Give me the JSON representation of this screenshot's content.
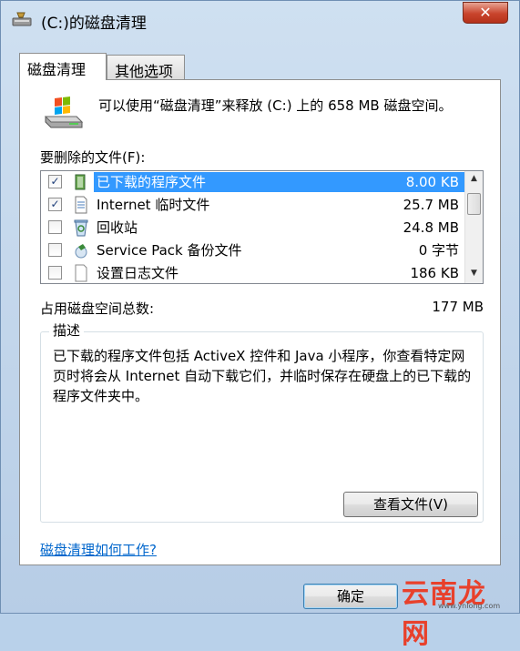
{
  "window": {
    "title": "(C:)的磁盘清理",
    "close_label": "✕"
  },
  "tabs": [
    {
      "label": "磁盘清理",
      "active": true
    },
    {
      "label": "其他选项",
      "active": false
    }
  ],
  "intro": "可以使用“磁盘清理”来释放 (C:) 上的 658 MB 磁盘空间。",
  "files_label": "要删除的文件(F):",
  "files": [
    {
      "name": "已下载的程序文件",
      "size": "8.00 KB",
      "checked": true,
      "selected": true,
      "icon": "folder-icon"
    },
    {
      "name": "Internet 临时文件",
      "size": "25.7 MB",
      "checked": true,
      "selected": false,
      "icon": "document-lock-icon"
    },
    {
      "name": "回收站",
      "size": "24.8 MB",
      "checked": false,
      "selected": false,
      "icon": "recycle-bin-icon"
    },
    {
      "name": "Service Pack 备份文件",
      "size": "0 字节",
      "checked": false,
      "selected": false,
      "icon": "service-pack-icon"
    },
    {
      "name": "设置日志文件",
      "size": "186 KB",
      "checked": false,
      "selected": false,
      "icon": "document-icon"
    }
  ],
  "total_label": "占用磁盘空间总数:",
  "total_value": "177 MB",
  "description": {
    "title": "描述",
    "text": "已下载的程序文件包括 ActiveX 控件和 Java 小程序，你查看特定网页时将会从 Internet 自动下载它们，并临时保存在硬盘上的已下载的程序文件夹中。"
  },
  "view_files_button": "查看文件(V)",
  "help_link": "磁盘清理如何工作?",
  "ok_button": "确定",
  "watermark": {
    "text": "云南龙网",
    "sub": "www.ynlong.com"
  },
  "colors": {
    "selection": "#3399ff",
    "link": "#0066cc",
    "close": "#c9442c"
  }
}
